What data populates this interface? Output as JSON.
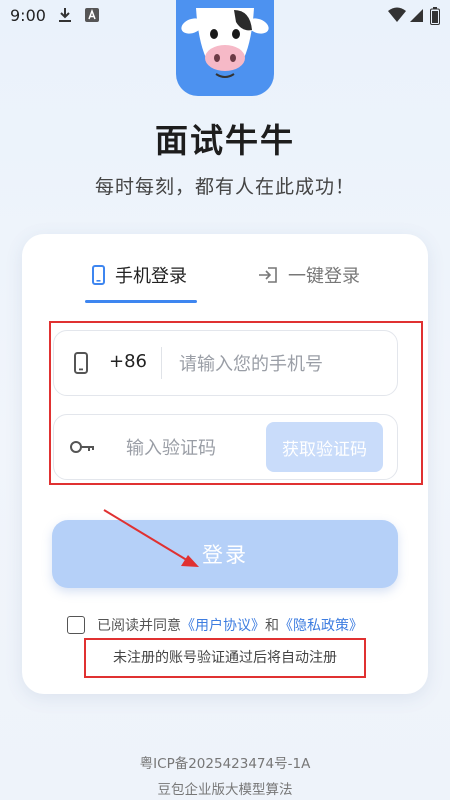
{
  "status_bar": {
    "time": "9:00",
    "icons": [
      "download-icon",
      "a-app-icon",
      "wifi-icon",
      "cellular-signal-icon",
      "battery-icon"
    ]
  },
  "app": {
    "logo": "cow-face-logo",
    "title": "面试牛牛",
    "slogan": "每时每刻，都有人在此成功！"
  },
  "tabs": [
    {
      "label": "手机登录",
      "icon": "phone-icon",
      "active": true
    },
    {
      "label": "一键登录",
      "icon": "login-arrow-icon",
      "active": false
    }
  ],
  "form": {
    "country_code": "+86",
    "phone_placeholder": "请输入您的手机号",
    "phone_value": "",
    "code_placeholder": "输入验证码",
    "code_value": "",
    "get_code_label": "获取验证码",
    "login_label": "登录"
  },
  "agreement": {
    "checked": false,
    "prefix": "已阅读并同意",
    "user_agreement": "《用户协议》",
    "and": "和",
    "privacy_policy": "《隐私政策》",
    "note": "未注册的账号验证通过后将自动注册"
  },
  "footer": {
    "icp": "粤ICP备2025423474号-1A",
    "algorithm": "豆包企业版大模型算法"
  },
  "colors": {
    "accent": "#3e86f0",
    "button_disabled": "#b5d0f8",
    "highlight_frame": "#e03131"
  }
}
